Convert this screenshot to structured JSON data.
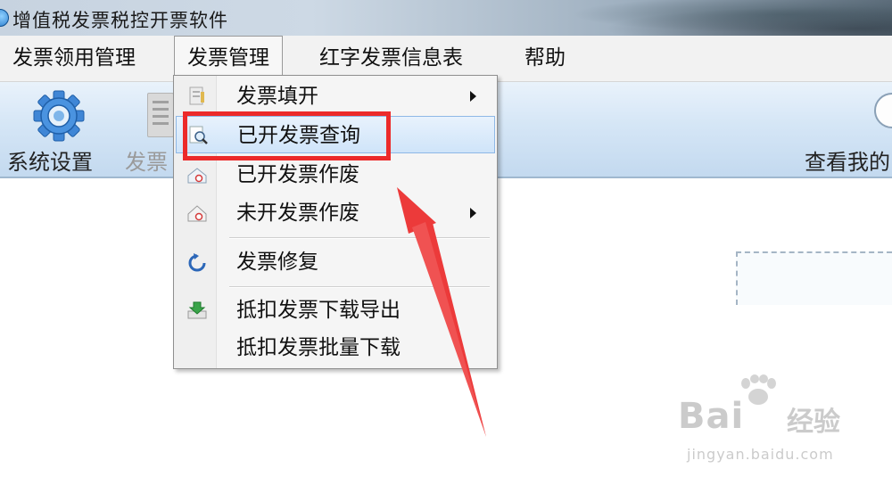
{
  "window": {
    "title": "增值税发票税控开票软件"
  },
  "menubar": {
    "items": [
      {
        "label": "发票领用管理"
      },
      {
        "label": "发票管理"
      },
      {
        "label": "红字发票信息表"
      },
      {
        "label": "帮助"
      }
    ]
  },
  "toolbar": {
    "system_settings": "系统设置",
    "invoice_partial": "发票",
    "view_mine_partial": "查看我的"
  },
  "dropdown": {
    "items": [
      {
        "label": "发票填开",
        "has_submenu": true,
        "icon": "invoice-fill-icon"
      },
      {
        "label": "已开发票查询",
        "has_submenu": false,
        "icon": "search-invoice-icon",
        "highlighted": true
      },
      {
        "label": "已开发票作废",
        "has_submenu": false,
        "icon": "void-issued-icon"
      },
      {
        "label": "未开发票作废",
        "has_submenu": true,
        "icon": "void-unissued-icon"
      },
      {
        "label": "发票修复",
        "has_submenu": false,
        "icon": "repair-icon"
      },
      {
        "label": "抵扣发票下载导出",
        "has_submenu": false,
        "icon": "download-export-icon"
      },
      {
        "label": "抵扣发票批量下载",
        "has_submenu": false,
        "icon": ""
      }
    ]
  },
  "watermark": {
    "brand_left": "Bai",
    "brand_right": "经验",
    "url": "jingyan.baidu.com"
  },
  "colors": {
    "annotation_red": "#ec2a2a",
    "highlight_blue": "#cfe4f9",
    "toolbar_blue": "#c3d9ef"
  }
}
